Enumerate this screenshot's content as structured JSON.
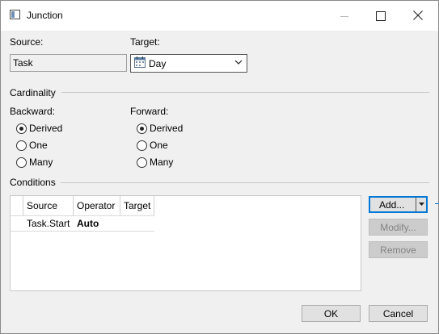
{
  "window": {
    "title": "Junction"
  },
  "fields": {
    "source_label": "Source:",
    "source_value": "Task",
    "target_label": "Target:",
    "target_value": "Day"
  },
  "cardinality": {
    "group_label": "Cardinality",
    "backward_label": "Backward:",
    "forward_label": "Forward:",
    "backward_options": [
      {
        "label": "Derived",
        "checked": true
      },
      {
        "label": "One",
        "checked": false
      },
      {
        "label": "Many",
        "checked": false
      }
    ],
    "forward_options": [
      {
        "label": "Derived",
        "checked": true
      },
      {
        "label": "One",
        "checked": false
      },
      {
        "label": "Many",
        "checked": false
      }
    ]
  },
  "conditions": {
    "group_label": "Conditions",
    "columns": [
      "Source",
      "Operator",
      "Target"
    ],
    "rows": [
      {
        "source": "Task.Start",
        "operator": "Auto",
        "target": ""
      }
    ],
    "add_label": "Add...",
    "modify_label": "Modify...",
    "remove_label": "Remove"
  },
  "footer": {
    "ok_label": "OK",
    "cancel_label": "Cancel"
  },
  "icons": {
    "app": "window-icon",
    "target_combo": "calendar-icon",
    "dropdown": "chevron-down-icon"
  },
  "colors": {
    "accent": "#0078d7",
    "dialog_bg": "#f0f0f0",
    "disabled_text": "#838383"
  }
}
